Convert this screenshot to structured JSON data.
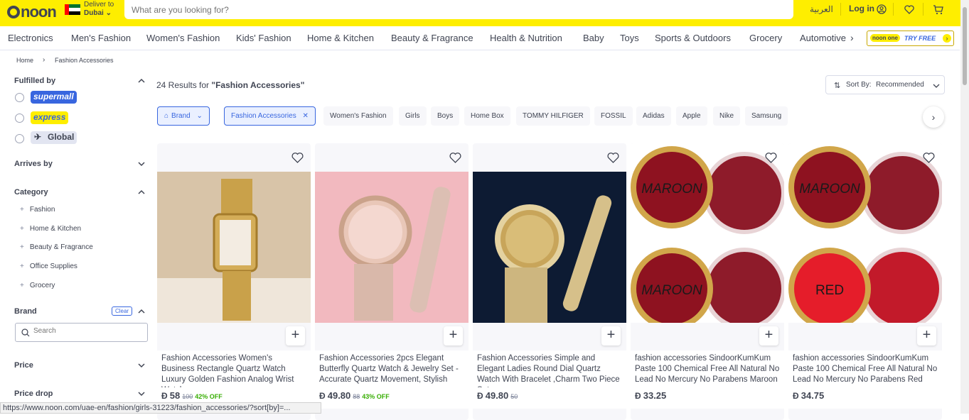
{
  "header": {
    "logo": "noon",
    "deliver_to_label": "Deliver to",
    "deliver_to_city": "Dubai",
    "search_placeholder": "What are you looking for?",
    "language": "العربية",
    "login_label": "Log in"
  },
  "nav": {
    "items": [
      "Electronics",
      "Men's Fashion",
      "Women's Fashion",
      "Kids' Fashion",
      "Home & Kitchen",
      "Beauty & Fragrance",
      "Health & Nutrition",
      "Baby",
      "Toys",
      "Sports & Outdoors",
      "Grocery",
      "Automotive"
    ],
    "noon_one_badge": "noon one",
    "try_free": "TRY FREE"
  },
  "breadcrumb": [
    "Home",
    "Fashion Accessories"
  ],
  "sidebar": {
    "fulfilled_by": "Fulfilled by",
    "fulfilled_options": [
      "supermall",
      "express",
      "Global"
    ],
    "arrives_by": "Arrives by",
    "category": "Category",
    "categories": [
      "Fashion",
      "Home & Kitchen",
      "Beauty & Fragrance",
      "Office Supplies",
      "Grocery"
    ],
    "brand": "Brand",
    "clear": "Clear",
    "brand_search_placeholder": "Search",
    "price": "Price",
    "price_drop": "Price drop"
  },
  "results": {
    "count_text": "24 Results for",
    "query": "\"Fashion Accessories\""
  },
  "sort": {
    "label": "Sort By:",
    "value": "Recommended"
  },
  "chips": {
    "brand": "Brand",
    "selected": "Fashion Accessories",
    "options": [
      "Women's Fashion",
      "Girls",
      "Boys",
      "Home Box",
      "TOMMY HILFIGER",
      "FOSSIL",
      "Adidas",
      "Apple",
      "Nike",
      "Samsung"
    ]
  },
  "products": [
    {
      "title": "Fashion Accessories Women's Business Rectangle Quartz Watch Luxury Golden Fashion Analog Wrist Watch",
      "price": "58",
      "old_price": "100",
      "discount": "42% OFF"
    },
    {
      "title": "Fashion Accessories 2pcs Elegant Butterfly Quartz Watch & Jewelry Set - Accurate Quartz Movement, Stylish",
      "price": "49.80",
      "old_price": "88",
      "discount": "43% OFF"
    },
    {
      "title": "Fashion Accessories Simple and Elegant Ladies Round Dial Quartz Watch With Bracelet ,Charm Two Piece Set",
      "price": "49.80",
      "old_price": "50",
      "discount": ""
    },
    {
      "title": "fashion accessories SindoorKumKum Paste 100 Chemical Free All Natural No Lead No Mercury No Parabens Maroon",
      "price": "33.25",
      "old_price": "",
      "discount": ""
    },
    {
      "title": "fashion accessories SindoorKumKum Paste 100 Chemical Free All Natural No Lead No Mercury No Parabens Red",
      "price": "34.75",
      "old_price": "",
      "discount": ""
    }
  ],
  "product_labels": {
    "maroon": "MAROON",
    "red": "RED"
  },
  "status_url": "https://www.noon.com/uae-en/fashion/girls-31223/fashion_accessories/?sort[by]=..."
}
